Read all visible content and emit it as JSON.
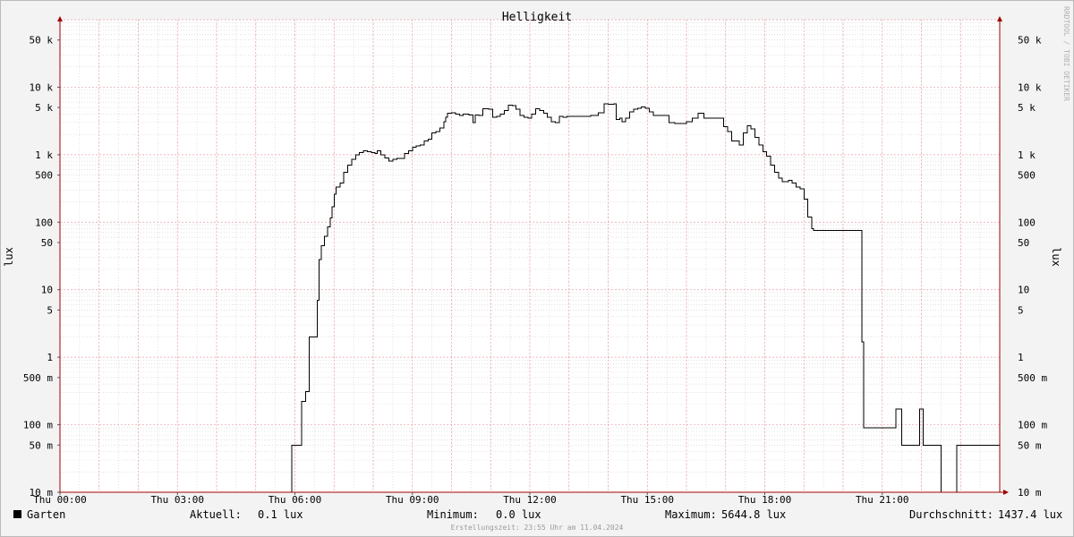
{
  "chart_data": {
    "type": "line",
    "title": "Helligkeit",
    "ylabel": "lux",
    "watermark": "RRDTOOL / TOBI OETIKER",
    "y_scale": "log",
    "ylim": [
      0.01,
      100000
    ],
    "xlim": [
      0,
      24
    ],
    "x_unit": "hours",
    "y_ticks": [
      {
        "v": 50000,
        "label": "50 k"
      },
      {
        "v": 10000,
        "label": "10 k"
      },
      {
        "v": 5000,
        "label": "5 k"
      },
      {
        "v": 1000,
        "label": "1 k"
      },
      {
        "v": 500,
        "label": "500"
      },
      {
        "v": 100,
        "label": "100"
      },
      {
        "v": 50,
        "label": "50"
      },
      {
        "v": 10,
        "label": "10"
      },
      {
        "v": 5,
        "label": "5"
      },
      {
        "v": 1,
        "label": "1"
      },
      {
        "v": 0.5,
        "label": "500 m"
      },
      {
        "v": 0.1,
        "label": "100 m"
      },
      {
        "v": 0.05,
        "label": "50 m"
      },
      {
        "v": 0.01,
        "label": "10 m"
      }
    ],
    "x_ticks": [
      {
        "h": 0,
        "label": "Thu 00:00"
      },
      {
        "h": 3,
        "label": "Thu 03:00"
      },
      {
        "h": 6,
        "label": "Thu 06:00"
      },
      {
        "h": 9,
        "label": "Thu 09:00"
      },
      {
        "h": 12,
        "label": "Thu 12:00"
      },
      {
        "h": 15,
        "label": "Thu 15:00"
      },
      {
        "h": 18,
        "label": "Thu 18:00"
      },
      {
        "h": 21,
        "label": "Thu 21:00"
      }
    ],
    "series": [
      {
        "name": "Garten",
        "color": "#000000",
        "points": [
          [
            0.0,
            0.01
          ],
          [
            5.9,
            0.01
          ],
          [
            5.92,
            0.05
          ],
          [
            6.15,
            0.05
          ],
          [
            6.17,
            0.22
          ],
          [
            6.25,
            0.22
          ],
          [
            6.27,
            0.31
          ],
          [
            6.35,
            0.31
          ],
          [
            6.37,
            2.0
          ],
          [
            6.55,
            2.0
          ],
          [
            6.57,
            7
          ],
          [
            6.62,
            28
          ],
          [
            6.67,
            45
          ],
          [
            6.75,
            62
          ],
          [
            6.83,
            85
          ],
          [
            6.9,
            115
          ],
          [
            6.95,
            170
          ],
          [
            7.0,
            260
          ],
          [
            7.05,
            330
          ],
          [
            7.15,
            380
          ],
          [
            7.25,
            550
          ],
          [
            7.35,
            700
          ],
          [
            7.45,
            850
          ],
          [
            7.55,
            1000
          ],
          [
            7.65,
            1080
          ],
          [
            7.75,
            1150
          ],
          [
            7.85,
            1100
          ],
          [
            7.95,
            1080
          ],
          [
            8.05,
            1050
          ],
          [
            8.1,
            1150
          ],
          [
            8.2,
            1000
          ],
          [
            8.3,
            900
          ],
          [
            8.4,
            800
          ],
          [
            8.5,
            850
          ],
          [
            8.6,
            880
          ],
          [
            8.7,
            880
          ],
          [
            8.8,
            1050
          ],
          [
            8.9,
            1150
          ],
          [
            9.0,
            1300
          ],
          [
            9.1,
            1350
          ],
          [
            9.2,
            1400
          ],
          [
            9.3,
            1600
          ],
          [
            9.4,
            1700
          ],
          [
            9.5,
            2100
          ],
          [
            9.6,
            2200
          ],
          [
            9.7,
            2500
          ],
          [
            9.8,
            3100
          ],
          [
            9.85,
            3600
          ],
          [
            9.9,
            4100
          ],
          [
            10.0,
            4200
          ],
          [
            10.1,
            4000
          ],
          [
            10.2,
            3800
          ],
          [
            10.3,
            4000
          ],
          [
            10.45,
            3900
          ],
          [
            10.55,
            3000
          ],
          [
            10.6,
            3900
          ],
          [
            10.7,
            3800
          ],
          [
            10.8,
            4800
          ],
          [
            10.95,
            4700
          ],
          [
            11.05,
            3600
          ],
          [
            11.15,
            3700
          ],
          [
            11.25,
            4000
          ],
          [
            11.35,
            4500
          ],
          [
            11.45,
            5400
          ],
          [
            11.55,
            5300
          ],
          [
            11.65,
            4700
          ],
          [
            11.75,
            3800
          ],
          [
            11.85,
            3600
          ],
          [
            11.95,
            3500
          ],
          [
            12.05,
            4000
          ],
          [
            12.15,
            4800
          ],
          [
            12.25,
            4500
          ],
          [
            12.35,
            4100
          ],
          [
            12.45,
            3600
          ],
          [
            12.55,
            3100
          ],
          [
            12.65,
            3000
          ],
          [
            12.75,
            3700
          ],
          [
            12.85,
            3600
          ],
          [
            12.95,
            3700
          ],
          [
            13.05,
            3700
          ],
          [
            13.2,
            3700
          ],
          [
            13.35,
            3700
          ],
          [
            13.55,
            3800
          ],
          [
            13.75,
            4200
          ],
          [
            13.9,
            5700
          ],
          [
            14.0,
            5600
          ],
          [
            14.15,
            5700
          ],
          [
            14.2,
            3300
          ],
          [
            14.3,
            3500
          ],
          [
            14.35,
            3100
          ],
          [
            14.45,
            3500
          ],
          [
            14.55,
            4300
          ],
          [
            14.65,
            4700
          ],
          [
            14.75,
            4900
          ],
          [
            14.85,
            5100
          ],
          [
            14.95,
            4900
          ],
          [
            15.05,
            4300
          ],
          [
            15.15,
            3800
          ],
          [
            15.3,
            3800
          ],
          [
            15.45,
            3800
          ],
          [
            15.55,
            3000
          ],
          [
            15.7,
            2900
          ],
          [
            15.85,
            2900
          ],
          [
            16.0,
            3100
          ],
          [
            16.15,
            3500
          ],
          [
            16.3,
            4100
          ],
          [
            16.45,
            3500
          ],
          [
            16.6,
            3500
          ],
          [
            16.75,
            3500
          ],
          [
            16.95,
            2600
          ],
          [
            17.05,
            2200
          ],
          [
            17.15,
            1600
          ],
          [
            17.25,
            1600
          ],
          [
            17.35,
            1400
          ],
          [
            17.45,
            2100
          ],
          [
            17.55,
            2700
          ],
          [
            17.65,
            2400
          ],
          [
            17.75,
            1800
          ],
          [
            17.85,
            1400
          ],
          [
            17.95,
            1100
          ],
          [
            18.05,
            950
          ],
          [
            18.15,
            700
          ],
          [
            18.25,
            550
          ],
          [
            18.35,
            450
          ],
          [
            18.45,
            400
          ],
          [
            18.6,
            420
          ],
          [
            18.7,
            380
          ],
          [
            18.8,
            330
          ],
          [
            18.9,
            310
          ],
          [
            19.0,
            220
          ],
          [
            19.1,
            120
          ],
          [
            19.2,
            80
          ],
          [
            19.25,
            75
          ],
          [
            19.4,
            75
          ],
          [
            19.6,
            75
          ],
          [
            20.2,
            75
          ],
          [
            20.45,
            75
          ],
          [
            20.48,
            1.7
          ],
          [
            20.52,
            0.09
          ],
          [
            20.9,
            0.09
          ],
          [
            21.3,
            0.09
          ],
          [
            21.35,
            0.17
          ],
          [
            21.45,
            0.17
          ],
          [
            21.5,
            0.05
          ],
          [
            21.9,
            0.05
          ],
          [
            21.95,
            0.17
          ],
          [
            22.0,
            0.17
          ],
          [
            22.05,
            0.05
          ],
          [
            22.45,
            0.05
          ],
          [
            22.5,
            0.01
          ],
          [
            22.85,
            0.01
          ],
          [
            22.9,
            0.05
          ],
          [
            23.2,
            0.05
          ]
        ]
      }
    ]
  },
  "legend": {
    "series_name": "Garten",
    "current_label": "Aktuell:",
    "current_value": "0.1 lux",
    "min_label": "Minimum:",
    "min_value": "0.0 lux",
    "max_label": "Maximum:",
    "max_value": "5644.8 lux",
    "avg_label": "Durchschnitt:",
    "avg_value": "1437.4 lux"
  },
  "footer": "Erstellungszeit: 23:55 Uhr am 11.04.2024",
  "colors": {
    "background": "#f3f3f3",
    "plot_background": "#ffffff",
    "major_grid": "#e8a0a8",
    "minor_grid": "#d0d0d0",
    "axis": "#a00000",
    "line": "#000000"
  }
}
